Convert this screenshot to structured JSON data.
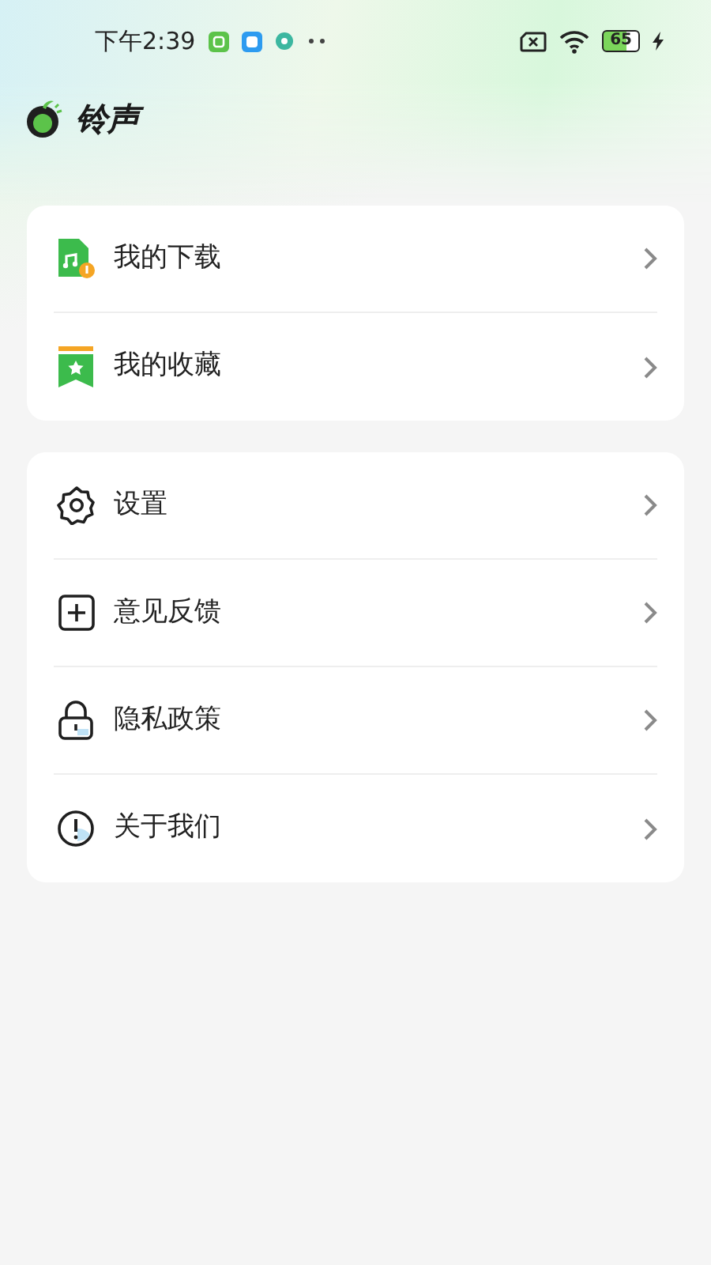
{
  "status_bar": {
    "time": "下午2:39",
    "battery": "65"
  },
  "header": {
    "title": "铃声"
  },
  "groups": [
    {
      "items": [
        {
          "label": "我的下载"
        },
        {
          "label": "我的收藏"
        }
      ]
    },
    {
      "items": [
        {
          "label": "设置"
        },
        {
          "label": "意见反馈"
        },
        {
          "label": "隐私政策"
        },
        {
          "label": "关于我们"
        }
      ]
    }
  ]
}
